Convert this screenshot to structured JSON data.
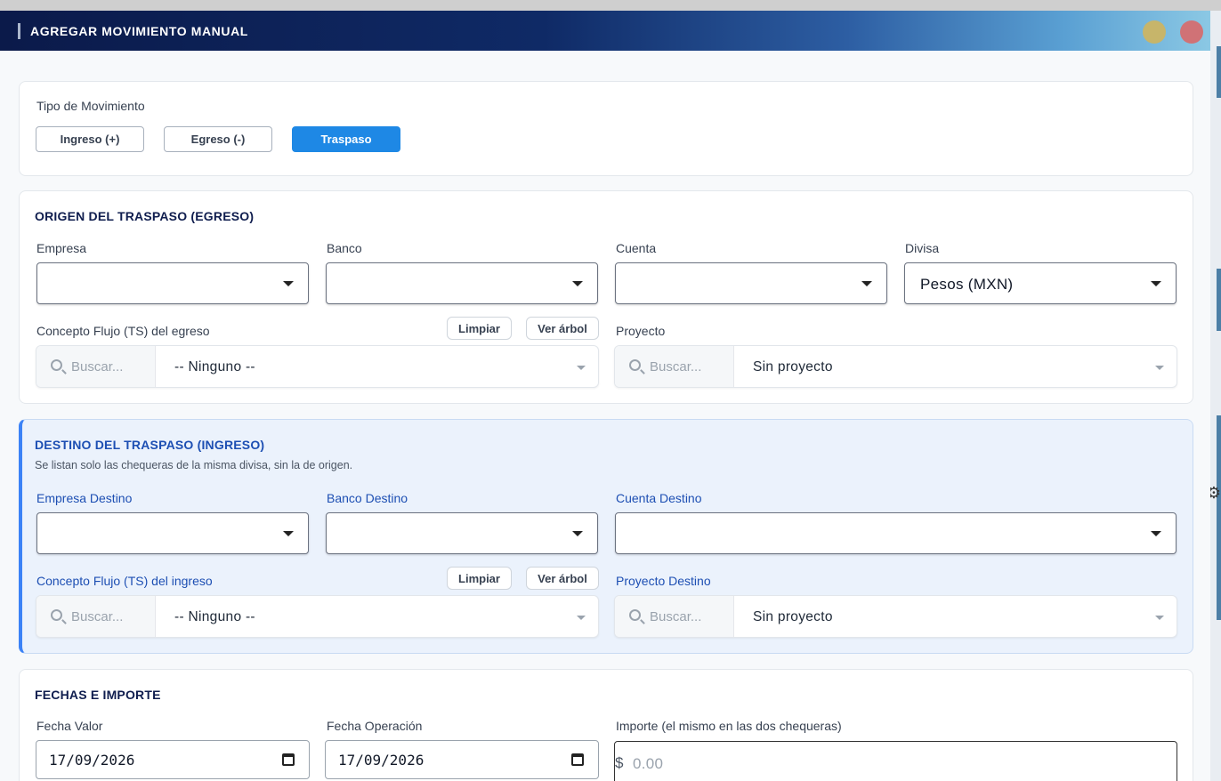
{
  "window": {
    "title": "AGREGAR MOVIMIENTO MANUAL"
  },
  "tipo": {
    "label": "Tipo de Movimiento",
    "options": [
      "Ingreso (+)",
      "Egreso (-)",
      "Traspaso"
    ],
    "selected": "Traspaso"
  },
  "origen": {
    "heading": "ORIGEN DEL TRASPASO (EGRESO)",
    "empresa_label": "Empresa",
    "empresa_value": "",
    "banco_label": "Banco",
    "banco_value": "",
    "cuenta_label": "Cuenta",
    "cuenta_value": "",
    "divisa_label": "Divisa",
    "divisa_value": "Pesos (MXN)",
    "concepto_label": "Concepto Flujo (TS) del egreso",
    "limpiar_label": "Limpiar",
    "ver_arbol_label": "Ver árbol",
    "concepto_search_placeholder": "Buscar...",
    "concepto_value": "-- Ninguno --",
    "proyecto_label": "Proyecto",
    "proyecto_search_placeholder": "Buscar...",
    "proyecto_value": "Sin proyecto"
  },
  "destino": {
    "heading": "DESTINO DEL TRASPASO (INGRESO)",
    "subtitle": "Se listan solo las chequeras de la misma divisa, sin la de origen.",
    "empresa_label": "Empresa Destino",
    "empresa_value": "",
    "banco_label": "Banco Destino",
    "banco_value": "",
    "cuenta_label": "Cuenta Destino",
    "cuenta_value": "",
    "concepto_label": "Concepto Flujo (TS) del ingreso",
    "limpiar_label": "Limpiar",
    "ver_arbol_label": "Ver árbol",
    "concepto_search_placeholder": "Buscar...",
    "concepto_value": "-- Ninguno --",
    "proyecto_label": "Proyecto Destino",
    "proyecto_search_placeholder": "Buscar...",
    "proyecto_value": "Sin proyecto"
  },
  "fechas": {
    "heading": "FECHAS E IMPORTE",
    "fecha_valor_label": "Fecha Valor",
    "fecha_valor": "17/09/2026",
    "fecha_operacion_label": "Fecha Operación",
    "fecha_operacion": "17/09/2026",
    "importe_label": "Importe (el mismo en las dos chequeras)",
    "importe_currency": "$",
    "importe_placeholder": "0.00"
  },
  "colors": {
    "accent": "#1e88e5",
    "heading": "#0f1d4e",
    "destino_accent": "#3b82f6"
  },
  "icons": [
    "search-icon",
    "caret-down-icon",
    "calendar-icon",
    "minimize-dot",
    "close-dot"
  ]
}
